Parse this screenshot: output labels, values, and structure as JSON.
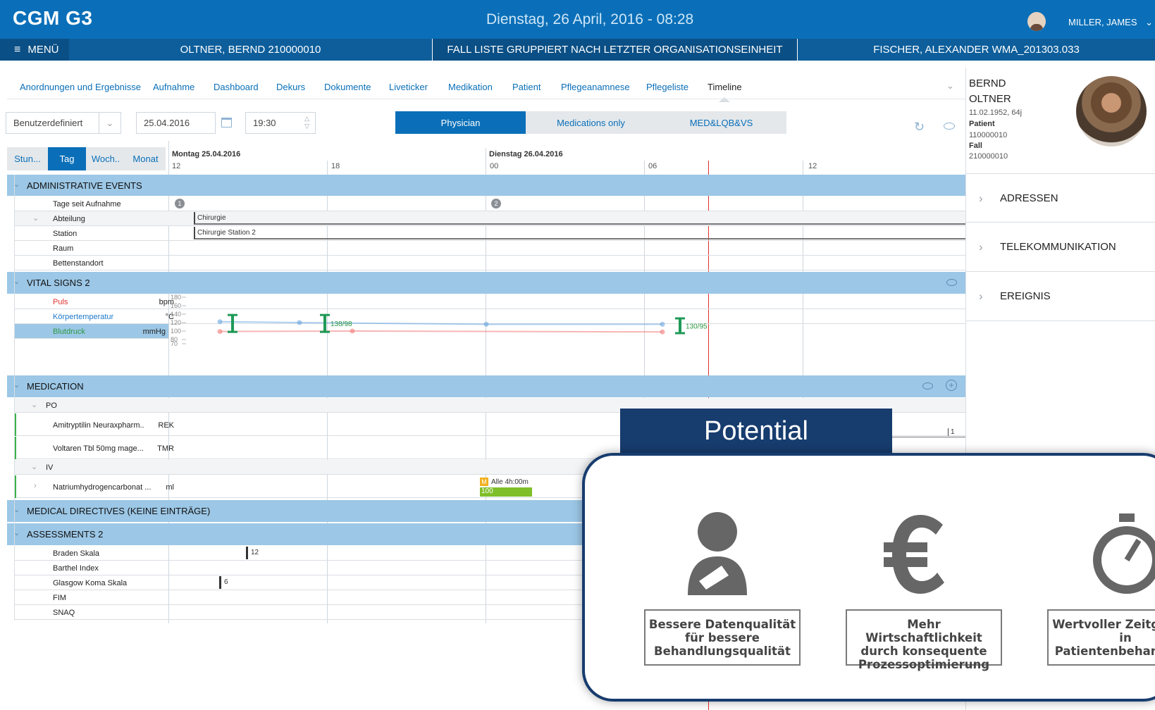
{
  "app": {
    "logo": "CGM G3",
    "datetime": "Dienstag, 26 April, 2016 - 08:28",
    "user": "MILLER, JAMES"
  },
  "subbar": {
    "menu": "MENÜ",
    "patient": "OLTNER, BERND 210000010",
    "fall_liste": "FALL LISTE GRUPPIERT NACH LETZTER ORGANISATIONSEINHEIT",
    "fischer": "FISCHER, ALEXANDER WMA_201303.033"
  },
  "tabs": [
    "Anordnungen und Ergebnisse",
    "Aufnahme",
    "Dashboard",
    "Dekurs",
    "Dokumente",
    "Liveticker",
    "Medikation",
    "Patient",
    "Pflegeanamnese",
    "Pflegeliste",
    "Timeline"
  ],
  "active_tab": "Timeline",
  "toolbar": {
    "preset": "Benutzerdefiniert",
    "date": "25.04.2016",
    "time": "19:30"
  },
  "filters": [
    "Physician",
    "Medications only",
    "MED&LQB&VS"
  ],
  "zoom": [
    "Stun...",
    "Tag",
    "Woch..",
    "Monat"
  ],
  "timeline": {
    "days": [
      {
        "label": "Montag 25.04.2016"
      },
      {
        "label": "Dienstag 26.04.2016"
      }
    ],
    "ticks": [
      "12",
      "18",
      "00",
      "06",
      "12"
    ],
    "now": "2016-04-26 08:28"
  },
  "sections": {
    "admin": {
      "title": "ADMINISTRATIVE EVENTS",
      "rows": [
        "Tage seit Aufnahme",
        "Abteilung",
        "Station",
        "Raum",
        "Bettenstandort"
      ],
      "day_badges": [
        "1",
        "2"
      ],
      "abteilung_value": "Chirurgie",
      "station_value": "Chirurgie Station 2"
    },
    "vitals": {
      "title": "VITAL SIGNS 2",
      "rows": [
        {
          "label": "Puls",
          "unit": "bpm",
          "color": "#e0312e"
        },
        {
          "label": "Körpertemperatur",
          "unit": "°C",
          "color": "#1e78c8"
        },
        {
          "label": "Blutdruck",
          "unit": "mmHg",
          "color": "#2f9a43"
        }
      ],
      "yticks": [
        "180",
        "160",
        "140",
        "120",
        "100",
        "80",
        "70"
      ],
      "bp_labels": [
        "138/98",
        "130/95"
      ]
    },
    "medication": {
      "title": "MEDICATION",
      "po": "PO",
      "iv": "IV",
      "items": [
        {
          "name": "Amitryptilin Neuraxpharm..",
          "code": "REK"
        },
        {
          "name": "Voltaren Tbl 50mg mage...",
          "code": "TMR"
        },
        {
          "name": "Natriumhydrogencarbonat ...",
          "code": "ml"
        }
      ],
      "med_badge": "M",
      "med_interval": "Alle 4h:00m",
      "med_value": "100",
      "qty": "1"
    },
    "directives": {
      "title": "MEDICAL DIRECTIVES (KEINE EINTRÄGE)"
    },
    "assessments": {
      "title": "ASSESSMENTS 2",
      "rows": [
        "Braden Skala",
        "Barthel Index",
        "Glasgow Koma Skala",
        "FIM",
        "SNAQ"
      ],
      "braden": "12",
      "glasgow": "6"
    }
  },
  "patient_card": {
    "first": "BERND",
    "last": "OLTNER",
    "dob": "11.02.1952, 64j",
    "patient_label": "Patient",
    "patient_id": "110000010",
    "fall_label": "Fall",
    "fall_id": "210000010",
    "items": [
      "ADRESSEN",
      "TELEKOMMUNIKATION",
      "EREIGNIS"
    ]
  },
  "overlay": {
    "title": "Potential",
    "benefits": [
      {
        "text": "Bessere Datenqualität für bessere Behandlungsqualität"
      },
      {
        "text": "Mehr Wirtschaftlichkeit durch konsequente Prozessoptimierung"
      },
      {
        "text": "Wertvoller Zeitgewinn in Patientenbehandlung"
      }
    ]
  }
}
